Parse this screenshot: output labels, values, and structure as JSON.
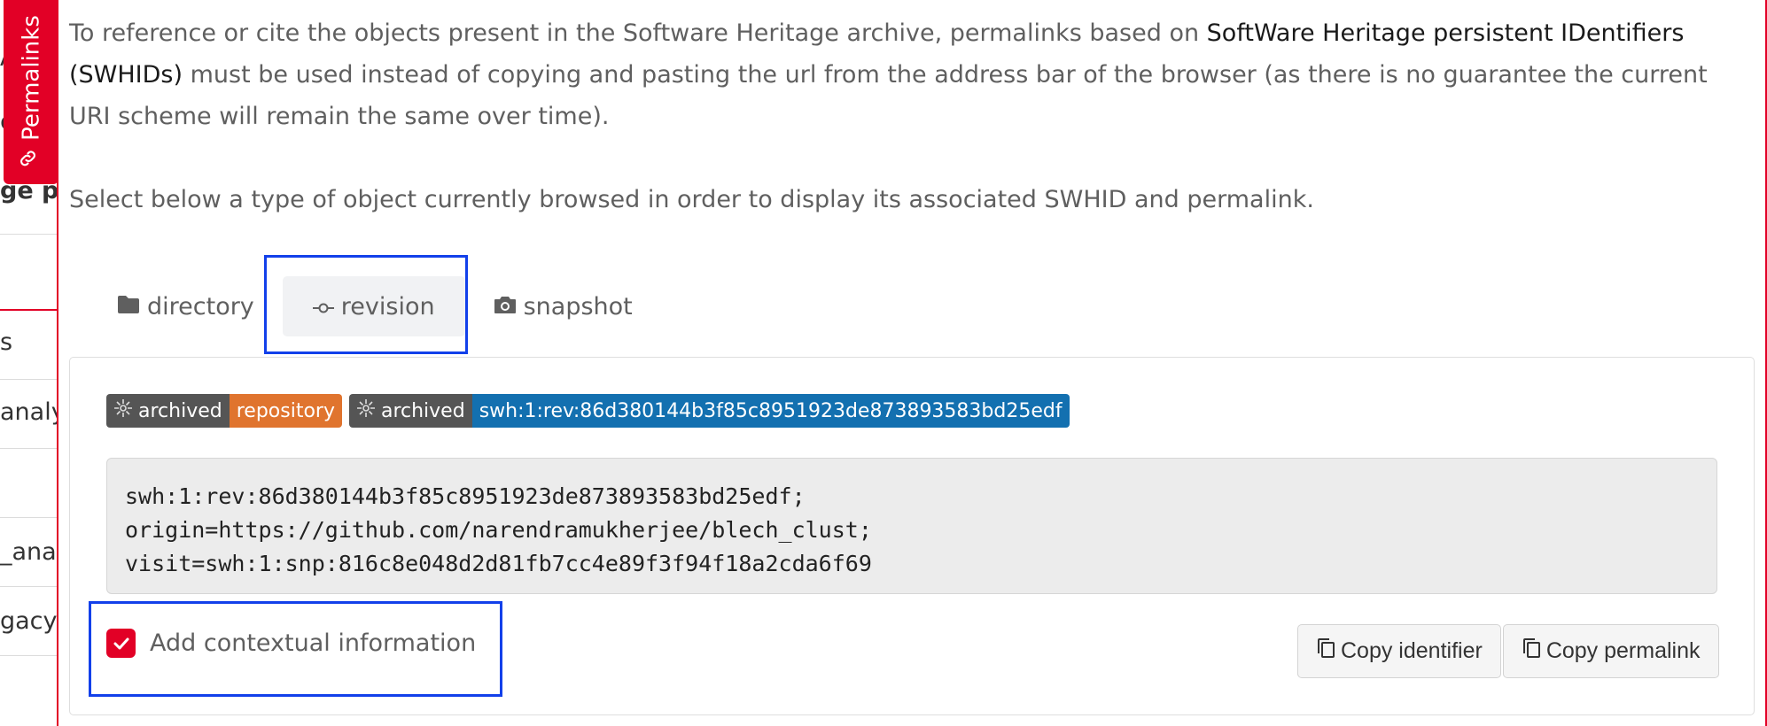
{
  "background_page": {
    "fragments": [
      "A",
      "e",
      "ge pu",
      "s",
      "analy",
      "_anal",
      "gacy_("
    ]
  },
  "permalinks_tab": {
    "label": "Permalinks",
    "icon": "link-icon"
  },
  "intro": {
    "part1": "To reference or cite the objects present in the Software Heritage archive, permalinks based on ",
    "link": "SoftWare Heritage persistent IDentifiers (SWHIDs)",
    "part2": " must be used instead of copying and pasting the url from the address bar of the browser (as there is no guarantee the current URI scheme will remain the same over time).",
    "select_text": "Select below a type of object currently browsed in order to display its associated SWHID and permalink."
  },
  "tabs": [
    {
      "label": "directory",
      "icon": "folder-icon",
      "active": false
    },
    {
      "label": "revision",
      "icon": "commit-icon",
      "active": true
    },
    {
      "label": "snapshot",
      "icon": "camera-icon",
      "active": false
    }
  ],
  "badges": [
    {
      "left": "archived",
      "right": "repository",
      "color": "#e0742e"
    },
    {
      "left": "archived",
      "right": "swh:1:rev:86d380144b3f85c8951923de873893583bd25edf",
      "color": "#1370b0"
    }
  ],
  "swhid_lines": [
    "swh:1:rev:86d380144b3f85c8951923de873893583bd25edf;",
    "origin=https://github.com/narendramukherjee/blech_clust;",
    "visit=swh:1:snp:816c8e048d2d81fb7cc4e89f3f94f18a2cda6f69"
  ],
  "contextual": {
    "label": "Add contextual information",
    "checked": true
  },
  "buttons": {
    "copy_identifier": "Copy identifier",
    "copy_permalink": "Copy permalink"
  },
  "colors": {
    "accent": "#e20026",
    "highlight": "#1240ea",
    "badge_dark": "#555555"
  }
}
